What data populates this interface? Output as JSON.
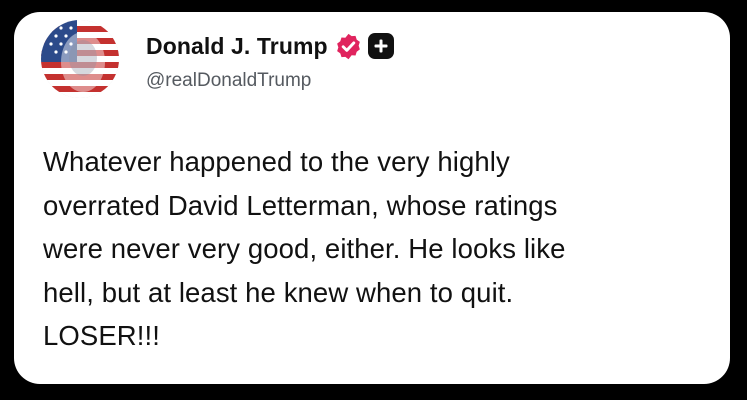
{
  "post": {
    "author": {
      "display_name": "Donald J. Trump",
      "handle": "@realDonaldTrump",
      "avatar_icon": "flag-portrait-avatar",
      "verified_icon": "verified-badge-icon",
      "verified_color": "#e0245e",
      "plus_icon": "plus-badge-icon"
    },
    "text": "Whatever happened to the very highly\noverrated David Letterman, whose ratings\nwere never very good, either. He looks like\nhell, but at least he knew when to quit.\nLOSER!!!"
  },
  "colors": {
    "background": "#000000",
    "card": "#ffffff",
    "text": "#111111",
    "handle": "#555a60"
  }
}
